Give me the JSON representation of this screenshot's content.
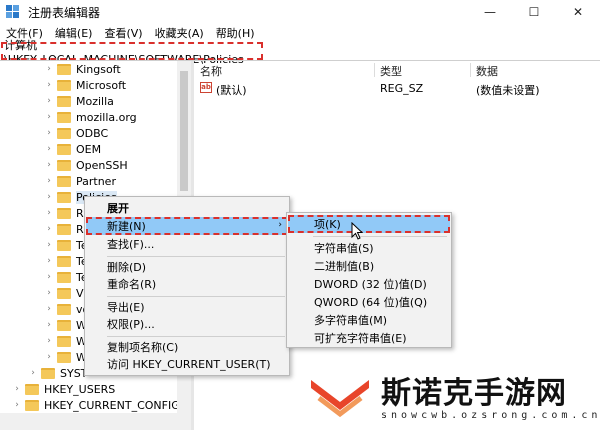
{
  "window": {
    "title": "注册表编辑器",
    "minimize": "—",
    "maximize": "☐",
    "close": "✕"
  },
  "menu": [
    "文件(F)",
    "编辑(E)",
    "查看(V)",
    "收藏夹(A)",
    "帮助(H)"
  ],
  "address": {
    "path": "计算机\\HKEY_LOCAL_MACHINE\\SOFTWARE\\Policies"
  },
  "tree": {
    "items": [
      "Kingsoft",
      "Microsoft",
      "Mozilla",
      "mozilla.org",
      "ODBC",
      "OEM",
      "OpenSSH",
      "Partner",
      "Policies",
      "R",
      "R",
      "Te",
      "Te",
      "Te",
      "V",
      "vo",
      "W",
      "W",
      "W",
      "SYST",
      "HKEY_USERS",
      "HKEY_CURRENT_CONFIG"
    ]
  },
  "values": {
    "columns": {
      "name": "名称",
      "type": "类型",
      "data": "数据"
    },
    "rows": [
      {
        "name": "(默认)",
        "type": "REG_SZ",
        "data": "(数值未设置)"
      }
    ]
  },
  "context_menu": {
    "items": [
      "展开",
      "新建(N)",
      "查找(F)...",
      "删除(D)",
      "重命名(R)",
      "导出(E)",
      "权限(P)...",
      "复制项名称(C)",
      "访问 HKEY_CURRENT_USER(T)"
    ]
  },
  "submenu": {
    "items": [
      "项(K)",
      "字符串值(S)",
      "二进制值(B)",
      "DWORD (32 位)值(D)",
      "QWORD (64 位)值(Q)",
      "多字符串值(M)",
      "可扩充字符串值(E)"
    ]
  },
  "watermark": {
    "text": "斯诺克手游网",
    "url": "snowcwb.ozsrong.com.cn"
  },
  "colors": {
    "highlight": "#91c9f7",
    "annotation": "#d9302c",
    "folder": "#f4c85a"
  }
}
